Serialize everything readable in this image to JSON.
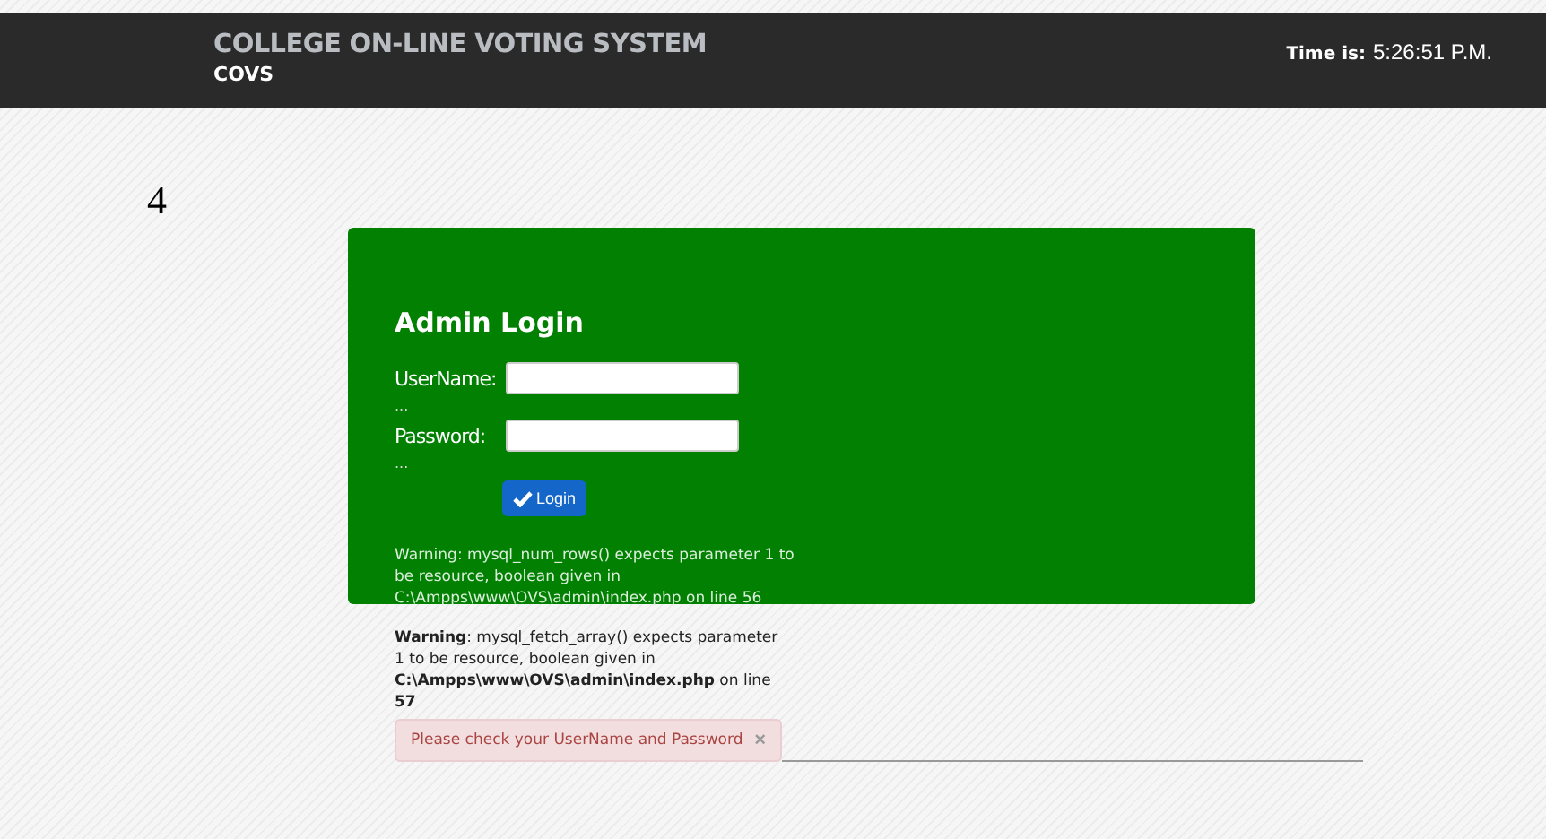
{
  "header": {
    "title": "COLLEGE ON-LINE VOTING SYSTEM",
    "subtitle": "COVS",
    "time_label": "Time is:",
    "time": "5:26:51 P.M."
  },
  "mark": "4",
  "login": {
    "title": "Admin Login",
    "fields": [
      {
        "label": "UserName:",
        "note": "..."
      },
      {
        "label": "Password:",
        "note": "..."
      }
    ],
    "button": "Login",
    "warning": "Warning: mysql_num_rows() expects parameter 1 to be resource, boolean given in C:\\Ampps\\www\\OVS\\admin\\index.php on line 56"
  },
  "warning": "**Warning**: mysql_fetch_array() expects parameter 1 to be resource, boolean given in **C:\\Ampps\\www\\OVS\\admin\\index.php** on line **57**",
  "alert": {
    "message": "Please check your UserName and Password",
    "close": "×"
  }
}
